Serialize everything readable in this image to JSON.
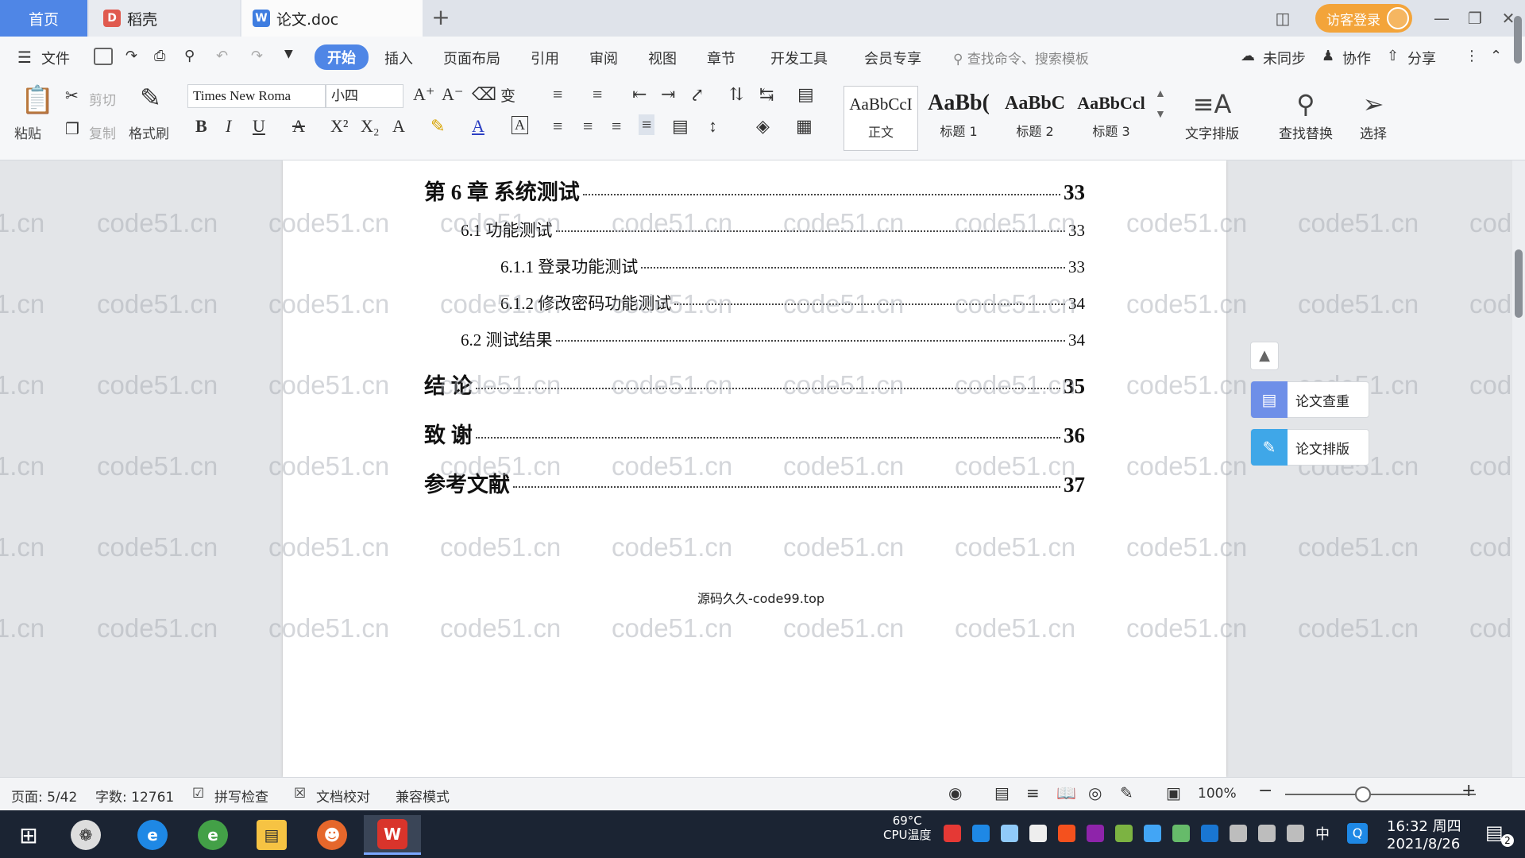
{
  "tabs": {
    "home": "首页",
    "daoke": "稻壳",
    "doc": "论文.doc"
  },
  "titlebar": {
    "login": "访客登录"
  },
  "menu": {
    "file": "文件",
    "items": [
      "开始",
      "插入",
      "页面布局",
      "引用",
      "审阅",
      "视图",
      "章节",
      "开发工具",
      "会员专享"
    ],
    "search_placeholder": "查找命令、搜索模板",
    "sync": "未同步",
    "collab": "协作",
    "share": "分享"
  },
  "ribbon": {
    "paste": "粘贴",
    "cut": "剪切",
    "copy": "复制",
    "format_painter": "格式刷",
    "font_name": "Times New Roma",
    "font_size": "小四",
    "styles": [
      {
        "sample": "AaBbCcI",
        "name": "正文"
      },
      {
        "sample": "AaBb(",
        "name": "标题 1"
      },
      {
        "sample": "AaBbC",
        "name": "标题 2"
      },
      {
        "sample": "AaBbCcl",
        "name": "标题 3"
      }
    ],
    "text_layout": "文字排版",
    "find_replace": "查找替换",
    "select": "选择"
  },
  "toc": [
    {
      "title": "第 6 章  系统测试",
      "page": "33",
      "level": 1
    },
    {
      "title": "6.1  功能测试",
      "page": "33",
      "level": 2
    },
    {
      "title": "6.1.1  登录功能测试",
      "page": "33",
      "level": 3
    },
    {
      "title": "6.1.2  修改密码功能测试",
      "page": "34",
      "level": 3
    },
    {
      "title": "6.2  测试结果",
      "page": "34",
      "level": 2
    },
    {
      "title": "结    论",
      "page": "35",
      "level": 1
    },
    {
      "title": "致    谢",
      "page": "36",
      "level": 1
    },
    {
      "title": "参考文献",
      "page": "37",
      "level": 1
    }
  ],
  "overlay_text": "源码久久-code99.top",
  "watermark": "code51.cn",
  "side_panel": {
    "check": "论文查重",
    "format": "论文排版"
  },
  "status": {
    "page": "页面: 5/42",
    "words": "字数: 12761",
    "spell": "拼写检查",
    "proof": "文档校对",
    "compat": "兼容模式",
    "zoom": "100%",
    "zoom_level_percent": 100
  },
  "taskbar": {
    "cpu_temp": "69°C",
    "cpu_label": "CPU温度",
    "time": "16:32 周四",
    "date": "2021/8/26",
    "ime": "中",
    "notif_count": "2"
  },
  "colors": {
    "accent": "#4f86e6",
    "login": "#f3a43a",
    "taskbar": "#1b2433"
  }
}
